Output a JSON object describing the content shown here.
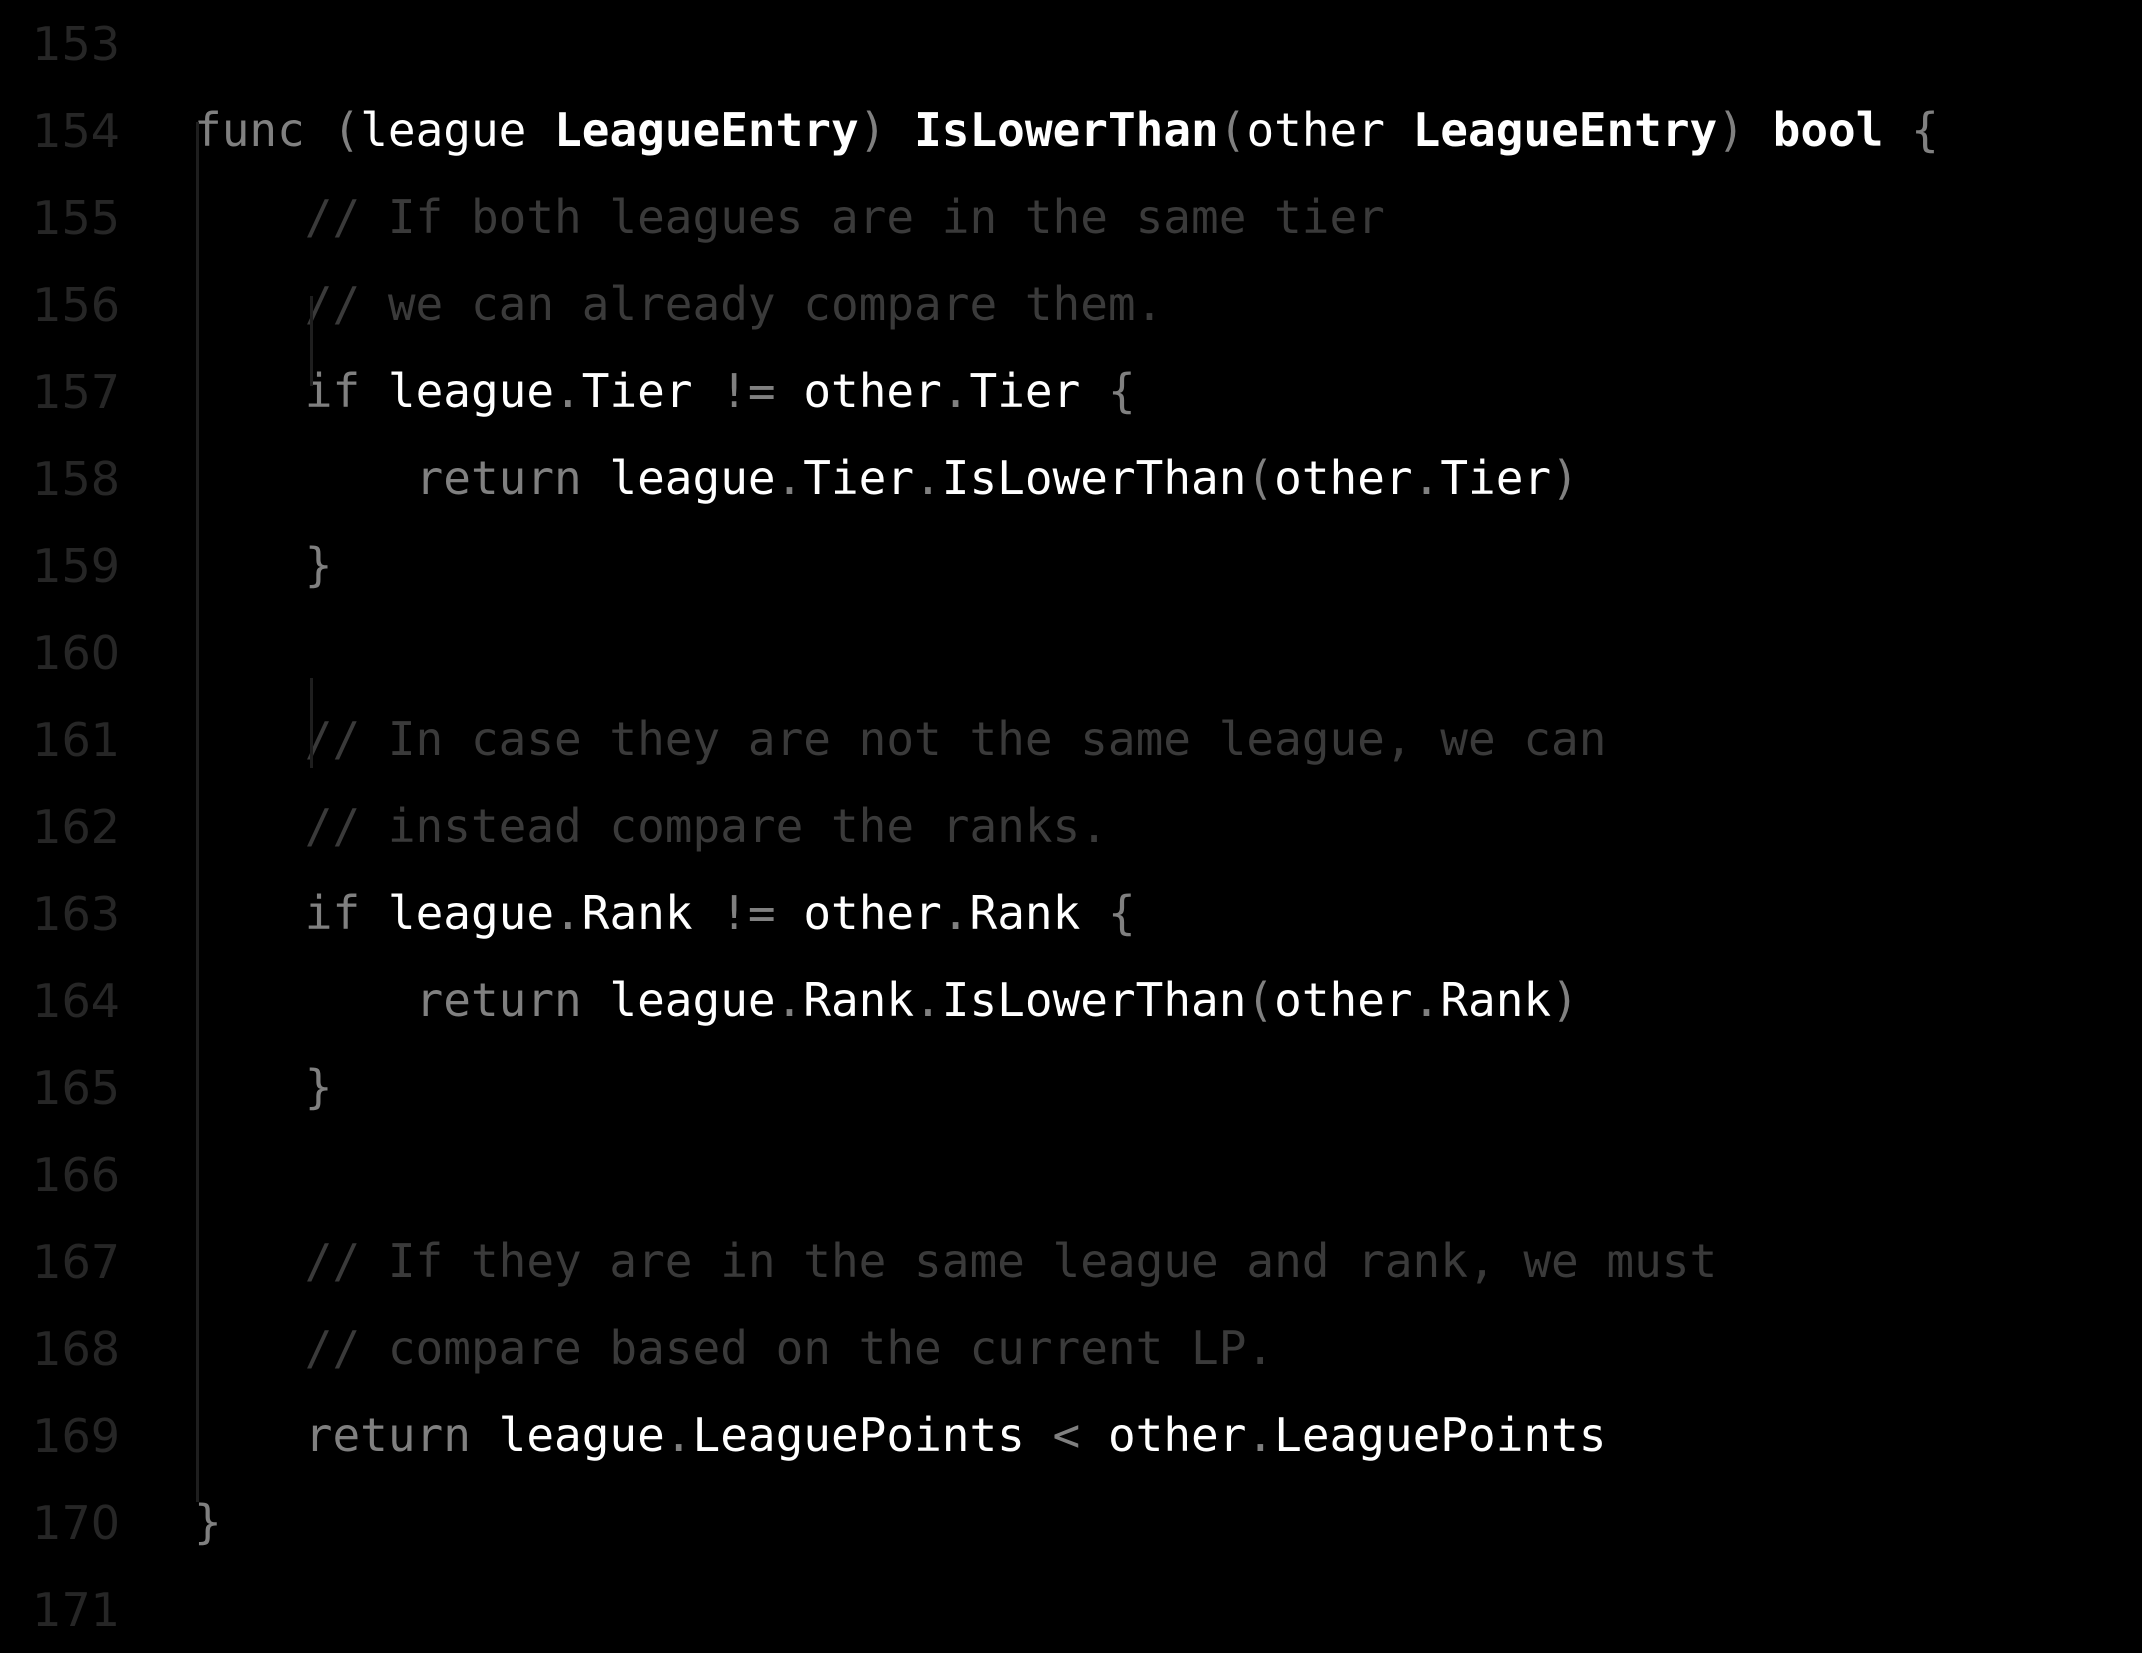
{
  "editor": {
    "language": "go",
    "background_color": "#000000",
    "gutter_color": "#262626",
    "text_color": "#ffffff",
    "keyword_color": "#808080",
    "comment_color": "#3a3a3a",
    "punctuation_color": "#808080",
    "first_line_number": 153,
    "last_line_number": 171
  },
  "lines": [
    {
      "number": "153",
      "tokens": []
    },
    {
      "number": "154",
      "tokens": [
        {
          "t": "func ",
          "c": "kw"
        },
        {
          "t": "(",
          "c": "punc"
        },
        {
          "t": "league ",
          "c": "plain"
        },
        {
          "t": "LeagueEntry",
          "c": "bold"
        },
        {
          "t": ") ",
          "c": "punc"
        },
        {
          "t": "IsLowerThan",
          "c": "bold"
        },
        {
          "t": "(",
          "c": "punc"
        },
        {
          "t": "other ",
          "c": "plain"
        },
        {
          "t": "LeagueEntry",
          "c": "bold"
        },
        {
          "t": ") ",
          "c": "punc"
        },
        {
          "t": "bool",
          "c": "bold"
        },
        {
          "t": " {",
          "c": "punc"
        }
      ]
    },
    {
      "number": "155",
      "tokens": [
        {
          "t": "    // If both leagues are in the same tier",
          "c": "comment"
        }
      ]
    },
    {
      "number": "156",
      "tokens": [
        {
          "t": "    // we can already compare them.",
          "c": "comment"
        }
      ]
    },
    {
      "number": "157",
      "tokens": [
        {
          "t": "    if ",
          "c": "kw"
        },
        {
          "t": "league",
          "c": "plain"
        },
        {
          "t": ".",
          "c": "punc"
        },
        {
          "t": "Tier",
          "c": "plain"
        },
        {
          "t": " != ",
          "c": "punc"
        },
        {
          "t": "other",
          "c": "plain"
        },
        {
          "t": ".",
          "c": "punc"
        },
        {
          "t": "Tier",
          "c": "plain"
        },
        {
          "t": " {",
          "c": "punc"
        }
      ]
    },
    {
      "number": "158",
      "tokens": [
        {
          "t": "        return ",
          "c": "kw"
        },
        {
          "t": "league",
          "c": "plain"
        },
        {
          "t": ".",
          "c": "punc"
        },
        {
          "t": "Tier",
          "c": "plain"
        },
        {
          "t": ".",
          "c": "punc"
        },
        {
          "t": "IsLowerThan",
          "c": "plain"
        },
        {
          "t": "(",
          "c": "punc"
        },
        {
          "t": "other",
          "c": "plain"
        },
        {
          "t": ".",
          "c": "punc"
        },
        {
          "t": "Tier",
          "c": "plain"
        },
        {
          "t": ")",
          "c": "punc"
        }
      ]
    },
    {
      "number": "159",
      "tokens": [
        {
          "t": "    }",
          "c": "punc"
        }
      ]
    },
    {
      "number": "160",
      "tokens": []
    },
    {
      "number": "161",
      "tokens": [
        {
          "t": "    // In case they are not the same league, we can",
          "c": "comment"
        }
      ]
    },
    {
      "number": "162",
      "tokens": [
        {
          "t": "    // instead compare the ranks.",
          "c": "comment"
        }
      ]
    },
    {
      "number": "163",
      "tokens": [
        {
          "t": "    if ",
          "c": "kw"
        },
        {
          "t": "league",
          "c": "plain"
        },
        {
          "t": ".",
          "c": "punc"
        },
        {
          "t": "Rank",
          "c": "plain"
        },
        {
          "t": " != ",
          "c": "punc"
        },
        {
          "t": "other",
          "c": "plain"
        },
        {
          "t": ".",
          "c": "punc"
        },
        {
          "t": "Rank",
          "c": "plain"
        },
        {
          "t": " {",
          "c": "punc"
        }
      ]
    },
    {
      "number": "164",
      "tokens": [
        {
          "t": "        return ",
          "c": "kw"
        },
        {
          "t": "league",
          "c": "plain"
        },
        {
          "t": ".",
          "c": "punc"
        },
        {
          "t": "Rank",
          "c": "plain"
        },
        {
          "t": ".",
          "c": "punc"
        },
        {
          "t": "IsLowerThan",
          "c": "plain"
        },
        {
          "t": "(",
          "c": "punc"
        },
        {
          "t": "other",
          "c": "plain"
        },
        {
          "t": ".",
          "c": "punc"
        },
        {
          "t": "Rank",
          "c": "plain"
        },
        {
          "t": ")",
          "c": "punc"
        }
      ]
    },
    {
      "number": "165",
      "tokens": [
        {
          "t": "    }",
          "c": "punc"
        }
      ]
    },
    {
      "number": "166",
      "tokens": []
    },
    {
      "number": "167",
      "tokens": [
        {
          "t": "    // If they are in the same league and rank, we must",
          "c": "comment"
        }
      ]
    },
    {
      "number": "168",
      "tokens": [
        {
          "t": "    // compare based on the current LP.",
          "c": "comment"
        }
      ]
    },
    {
      "number": "169",
      "tokens": [
        {
          "t": "    return ",
          "c": "kw"
        },
        {
          "t": "league",
          "c": "plain"
        },
        {
          "t": ".",
          "c": "punc"
        },
        {
          "t": "LeaguePoints",
          "c": "plain"
        },
        {
          "t": " < ",
          "c": "punc"
        },
        {
          "t": "other",
          "c": "plain"
        },
        {
          "t": ".",
          "c": "punc"
        },
        {
          "t": "LeaguePoints",
          "c": "plain"
        }
      ]
    },
    {
      "number": "170",
      "tokens": [
        {
          "t": "}",
          "c": "punc"
        }
      ]
    },
    {
      "number": "171",
      "tokens": []
    }
  ]
}
